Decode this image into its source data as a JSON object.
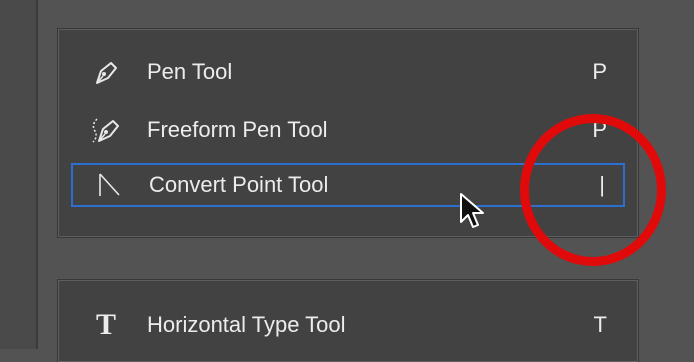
{
  "pen_tool_group": {
    "tools": [
      {
        "label": "Pen Tool",
        "shortcut": "P",
        "icon": "pen-icon"
      },
      {
        "label": "Freeform Pen Tool",
        "shortcut": "P",
        "icon": "freeform-pen-icon"
      },
      {
        "label": "Convert Point Tool",
        "shortcut": "|",
        "icon": "convert-point-icon",
        "selected": true
      }
    ]
  },
  "type_tool_group": {
    "tools": [
      {
        "label": "Horizontal Type Tool",
        "shortcut": "T",
        "icon": "type-icon",
        "glyph": "T"
      }
    ]
  },
  "colors": {
    "selection_border": "#2c6fd0",
    "annotation_circle": "#e10a0a",
    "panel_bg": "#424242",
    "app_bg": "#535353"
  }
}
